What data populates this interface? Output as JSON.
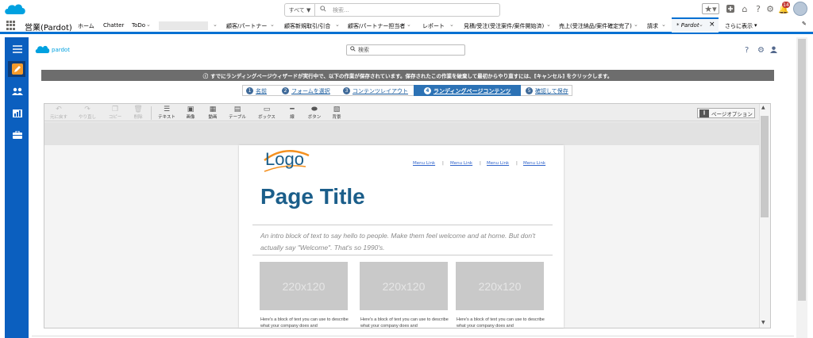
{
  "header": {
    "search_scope": "すべて ▼",
    "search_placeholder": "検索...",
    "notification_count": "14"
  },
  "nav": {
    "app_name": "営業(Pardot)",
    "items": [
      "ホーム",
      "Chatter",
      "ToDo",
      "顧客/パートナー",
      "顧客新規取引/引合",
      "顧客/パートナー担当者",
      "レポート",
      "見積/受注(受注案件/案件開始済)",
      "売上(受注納品/案件確定完了)",
      "請求",
      "* Pardot",
      "さらに表示"
    ]
  },
  "pardot": {
    "search_placeholder": "検索"
  },
  "banner": {
    "text": "すでにランディングページウィザードが実行中で、以下の作業が保存されています。保存されたこの作業を破棄して最初からやり直すには、[キャンセル] をクリックします。"
  },
  "wizard": {
    "steps": [
      {
        "num": "1",
        "label": "名前"
      },
      {
        "num": "2",
        "label": "フォームを選択"
      },
      {
        "num": "3",
        "label": "コンテンツレイアウト"
      },
      {
        "num": "4",
        "label": "ランディングページコンテンツ"
      },
      {
        "num": "5",
        "label": "確認して保存"
      }
    ]
  },
  "toolbar": {
    "undo": "元に戻す",
    "redo": "やり直し",
    "copy": "コピー",
    "delete": "削除",
    "text": "テキスト",
    "image": "画像",
    "video": "動画",
    "table": "テーブル",
    "box": "ボックス",
    "line": "線",
    "button": "ボタン",
    "background": "背景",
    "page_options": "ページオプション"
  },
  "landing_page": {
    "logo": "Logo",
    "menu_links": [
      "Menu Link",
      "Menu Link",
      "Menu Link",
      "Menu Link"
    ],
    "title": "Page Title",
    "intro": "An intro block of text to say hello to people. Make them feel welcome and at home. But don't actually say \"Welcome\". That's so 1990's.",
    "image_placeholder": "220x120",
    "caption": "Here's a block of text you can use to describe what your company does and"
  }
}
